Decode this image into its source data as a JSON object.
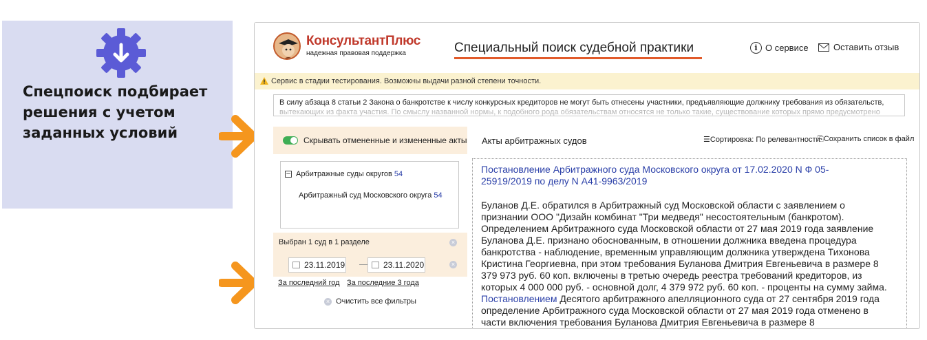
{
  "promo": {
    "text": "Спецпоиск подбирает решения с учетом заданных условий",
    "icon": "gear-download-icon"
  },
  "header": {
    "logo_title": "КонсультантПлюс",
    "logo_subtitle": "надежная правовая поддержка",
    "page_title": "Специальный поиск судебной практики",
    "about_label": "О сервисе",
    "feedback_label": "Оставить отзыв"
  },
  "warning": {
    "text": "Сервис в стадии тестирования. Возможны выдачи разной степени точности."
  },
  "query": {
    "line1": "В силу абзаца 8 статьи 2 Закона о банкротстве к числу конкурсных кредиторов не могут быть отнесены участники, предъявляющие должнику требования из обязательств,",
    "line2": "вытекающих из факта участия. По смыслу названной нормы, к подобного рода обязательствам относятся не только такие, существование которых прямо предусмотрено"
  },
  "filters": {
    "toggle_label": "Скрывать отмененные и измененные акты",
    "toggle_on": true,
    "group_label": "Арбитражные суды округов",
    "group_count": "54",
    "item_label": "Арбитражный суд Московского округа",
    "item_count": "54",
    "selected_text": "Выбран 1 суд в 1 разделе",
    "date_from": "23.11.2019",
    "date_to": "23.11.2020",
    "quick_last_year": "За последний год",
    "quick_last_3_years": "За последние 3 года",
    "clear_all": "Очистить все фильтры"
  },
  "results": {
    "heading": "Акты арбитражных судов",
    "sort_label": "Сортировка: По релевантности",
    "save_label": "Сохранить список в файл",
    "doc_title": "Постановление Арбитражного суда Московского округа от 17.02.2020 N Ф 05-25919/2019 по делу N А41-9963/2019",
    "body_part1": "Буланов Д.Е. обратился в Арбитражный суд Московской области с заявлением о признании ООО \"Дизайн комбинат \"Три медведя\" несостоятельным (банкротом). Определением Арбитражного суда Московской области от 27 мая 2019 года заявление Буланова Д.Е. признано обоснованным, в отношении должника введена процедура банкротства - наблюдение, временным управляющим должника утверждена Тихонова Кристина Георгиевна, при этом требования Буланова Дмитрия Евгеньевича в размере 8 379 973 руб. 60 коп. включены в третью очередь реестра требований кредиторов, из которых 4 000 000 руб. - основной долг, 4 379 972 руб. 60 коп. - проценты на сумму займа.",
    "body_link": "Постановлением",
    "body_part2": "Десятого арбитражного апелляционного суда от 27 сентября 2019 года определение Арбитражного суда Московской области от 27 мая 2019 года отменено в части включения требования Буланова Дмитрия Евгеньевича в размере 8"
  },
  "colors": {
    "accent_orange": "#f5961e",
    "highlight_purple": "#5b5bd6",
    "link_blue": "#2a3fa8",
    "promo_bg": "#d9dcf1"
  }
}
